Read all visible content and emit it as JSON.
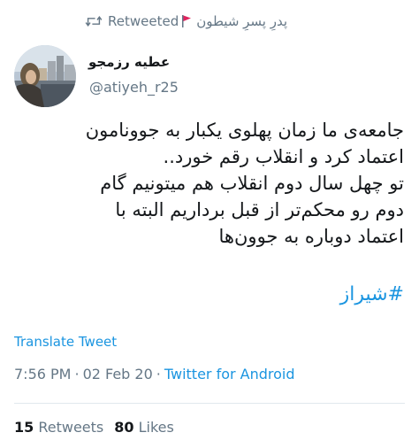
{
  "retweet": {
    "label": "Retweeted",
    "retweeter": "پدرِ پسرِ شیطون",
    "icon": "retweet-icon",
    "flag_icon": "red-flag-icon"
  },
  "author": {
    "display_name": "عطیه رزمجو",
    "username": "@atiyeh_r25"
  },
  "tweet": {
    "text": "جامعه‌ی ما زمان پهلوی یکبار به جوونامون\nاعتماد کرد و انقلاب رقم خورد..\nتو چهل سال دوم انقلاب هم میتونیم گام\nدوم رو محکم‌تر از قبل برداریم البته با\nاعتماد دوباره به جوون‌ها",
    "hashtag": "#شیراز"
  },
  "translate_label": "Translate Tweet",
  "meta": {
    "time": "7:56 PM",
    "separator": "·",
    "date": "02 Feb 20",
    "source": "Twitter for Android"
  },
  "stats": {
    "retweets_count": "15",
    "retweets_label": "Retweets",
    "likes_count": "80",
    "likes_label": "Likes"
  },
  "colors": {
    "link": "#1b95e0",
    "muted": "#657786",
    "text": "#14171a",
    "divider": "#e1e8ed",
    "flag": "#e0245e"
  }
}
